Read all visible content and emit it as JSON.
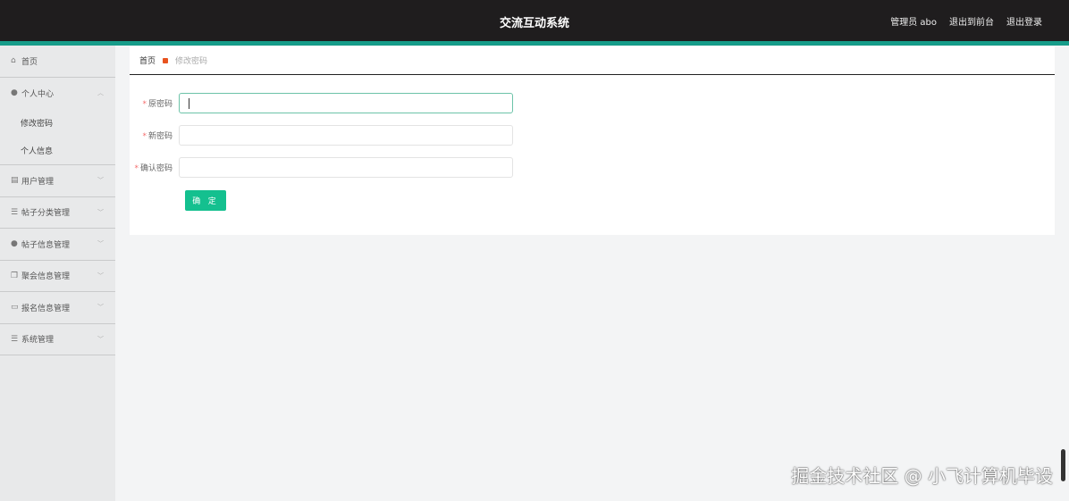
{
  "header": {
    "title": "交流互动系统",
    "user": "管理员 abo",
    "to_front": "退出到前台",
    "logout": "退出登录"
  },
  "sidebar": {
    "items": [
      {
        "label": "首页",
        "icon": "home-icon"
      },
      {
        "label": "个人中心",
        "icon": "user-icon",
        "expanded": true,
        "children": [
          "修改密码",
          "个人信息"
        ]
      },
      {
        "label": "用户管理",
        "icon": "clipboard-icon"
      },
      {
        "label": "帖子分类管理",
        "icon": "list-icon"
      },
      {
        "label": "帖子信息管理",
        "icon": "user-icon"
      },
      {
        "label": "聚会信息管理",
        "icon": "copy-icon"
      },
      {
        "label": "报名信息管理",
        "icon": "briefcase-icon"
      },
      {
        "label": "系统管理",
        "icon": "list-icon"
      }
    ]
  },
  "breadcrumb": {
    "home": "首页",
    "current": "修改密码"
  },
  "form": {
    "old_label": "原密码",
    "new_label": "新密码",
    "confirm_label": "确认密码",
    "old_value": "",
    "new_value": "",
    "confirm_value": "",
    "submit": "确 定"
  },
  "watermark": "掘金技术社区 @ 小飞计算机毕设"
}
